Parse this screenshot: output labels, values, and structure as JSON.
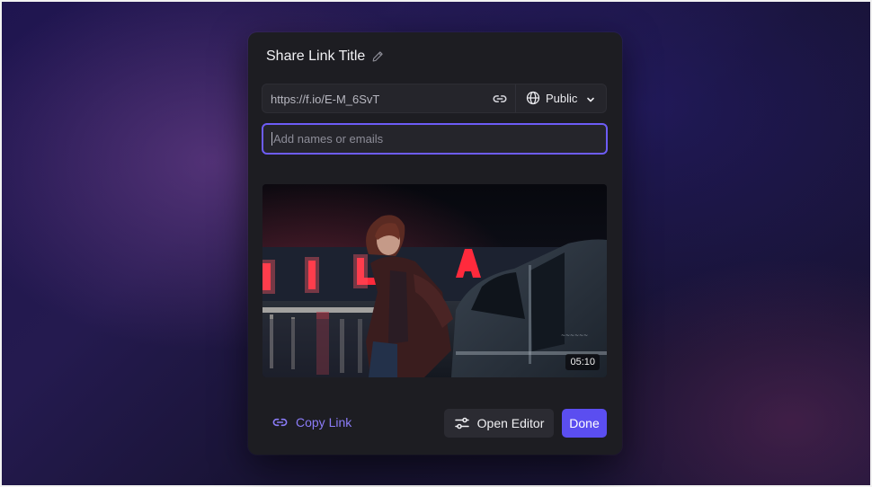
{
  "dialog": {
    "title": "Share Link Title",
    "title_icon": "pencil-icon"
  },
  "share_link": {
    "url": "https://f.io/E-M_6SvT",
    "copy_icon": "link-icon",
    "visibility": {
      "label": "Public",
      "icon": "globe-icon",
      "dropdown_icon": "chevron-down-icon"
    }
  },
  "invite": {
    "placeholder": "Add names or emails",
    "value": ""
  },
  "preview": {
    "duration": "05:10",
    "sign_text": "VILA"
  },
  "footer": {
    "copy_link_label": "Copy Link",
    "open_editor_label": "Open Editor",
    "done_label": "Done"
  },
  "colors": {
    "accent": "#5b4ef0",
    "accent_text": "#8b7cf8",
    "focus_border": "#6d5cf6",
    "modal_bg": "#1d1d22"
  }
}
